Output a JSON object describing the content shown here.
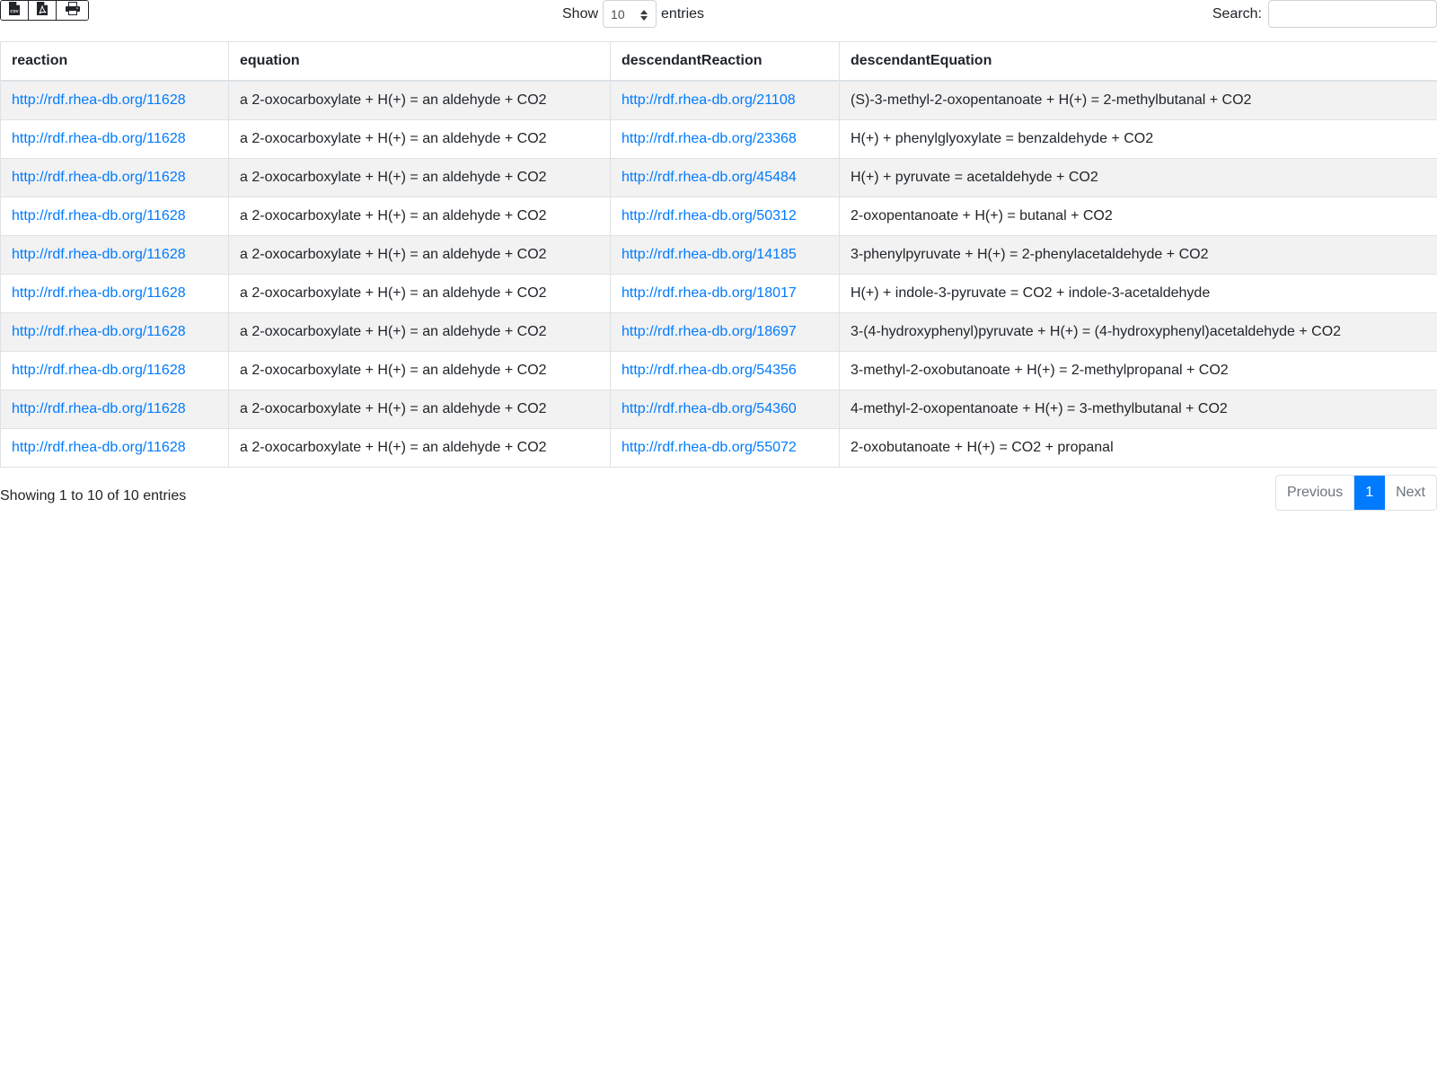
{
  "toolbar": {
    "export_buttons": [
      {
        "icon": "csv-file-icon"
      },
      {
        "icon": "pdf-file-icon"
      },
      {
        "icon": "print-icon"
      }
    ],
    "show_label": "Show",
    "page_length": "10",
    "entries_label": "entries",
    "search_label": "Search:",
    "search_value": ""
  },
  "table": {
    "columns": [
      "reaction",
      "equation",
      "descendantReaction",
      "descendantEquation"
    ],
    "rows": [
      [
        "http://rdf.rhea-db.org/11628",
        "a 2-oxocarboxylate + H(+) = an aldehyde + CO2",
        "http://rdf.rhea-db.org/21108",
        "(S)-3-methyl-2-oxopentanoate + H(+) = 2-methylbutanal + CO2"
      ],
      [
        "http://rdf.rhea-db.org/11628",
        "a 2-oxocarboxylate + H(+) = an aldehyde + CO2",
        "http://rdf.rhea-db.org/23368",
        "H(+) + phenylglyoxylate = benzaldehyde + CO2"
      ],
      [
        "http://rdf.rhea-db.org/11628",
        "a 2-oxocarboxylate + H(+) = an aldehyde + CO2",
        "http://rdf.rhea-db.org/45484",
        "H(+) + pyruvate = acetaldehyde + CO2"
      ],
      [
        "http://rdf.rhea-db.org/11628",
        "a 2-oxocarboxylate + H(+) = an aldehyde + CO2",
        "http://rdf.rhea-db.org/50312",
        "2-oxopentanoate + H(+) = butanal + CO2"
      ],
      [
        "http://rdf.rhea-db.org/11628",
        "a 2-oxocarboxylate + H(+) = an aldehyde + CO2",
        "http://rdf.rhea-db.org/14185",
        "3-phenylpyruvate + H(+) = 2-phenylacetaldehyde + CO2"
      ],
      [
        "http://rdf.rhea-db.org/11628",
        "a 2-oxocarboxylate + H(+) = an aldehyde + CO2",
        "http://rdf.rhea-db.org/18017",
        "H(+) + indole-3-pyruvate = CO2 + indole-3-acetaldehyde"
      ],
      [
        "http://rdf.rhea-db.org/11628",
        "a 2-oxocarboxylate + H(+) = an aldehyde + CO2",
        "http://rdf.rhea-db.org/18697",
        "3-(4-hydroxyphenyl)pyruvate + H(+) = (4-hydroxyphenyl)acetaldehyde + CO2"
      ],
      [
        "http://rdf.rhea-db.org/11628",
        "a 2-oxocarboxylate + H(+) = an aldehyde + CO2",
        "http://rdf.rhea-db.org/54356",
        "3-methyl-2-oxobutanoate + H(+) = 2-methylpropanal + CO2"
      ],
      [
        "http://rdf.rhea-db.org/11628",
        "a 2-oxocarboxylate + H(+) = an aldehyde + CO2",
        "http://rdf.rhea-db.org/54360",
        "4-methyl-2-oxopentanoate + H(+) = 3-methylbutanal + CO2"
      ],
      [
        "http://rdf.rhea-db.org/11628",
        "a 2-oxocarboxylate + H(+) = an aldehyde + CO2",
        "http://rdf.rhea-db.org/55072",
        "2-oxobutanoate + H(+) = CO2 + propanal"
      ]
    ]
  },
  "footer": {
    "info": "Showing 1 to 10 of 10 entries",
    "previous_label": "Previous",
    "current_page": "1",
    "next_label": "Next"
  },
  "colors": {
    "link": "#007bff",
    "active_page": "#007bff",
    "stripe": "#f2f2f2",
    "border": "#dee2e6"
  }
}
